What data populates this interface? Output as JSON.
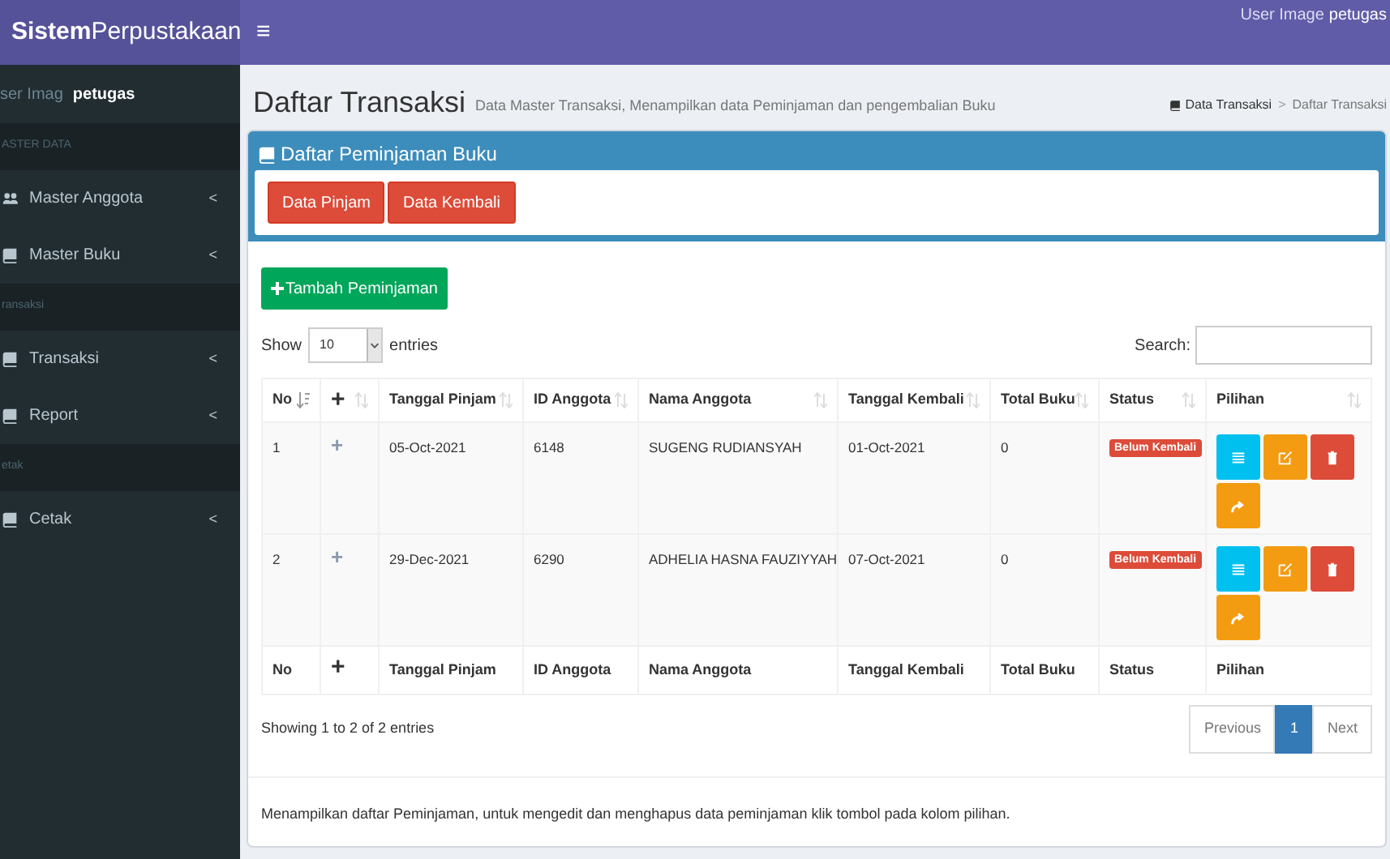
{
  "header": {
    "logo_bold": "Sistem",
    "logo_light": "Perpustakaan",
    "menu_toggle": "≡",
    "user_alt": "User Image",
    "user_name": "petugas"
  },
  "sidebar": {
    "user_alt": "ser Imag",
    "user_name": "petugas",
    "items": [
      {
        "kind": "header",
        "label": "ASTER DATA"
      },
      {
        "kind": "link",
        "label": "Master Anggota",
        "chevron": "<"
      },
      {
        "kind": "link",
        "label": "Master Buku",
        "chevron": "<"
      },
      {
        "kind": "header",
        "label": "ransaksi"
      },
      {
        "kind": "link",
        "label": "Transaksi",
        "chevron": "<"
      },
      {
        "kind": "link",
        "label": "Report",
        "chevron": "<"
      },
      {
        "kind": "header",
        "label": "etak"
      },
      {
        "kind": "link",
        "label": "Cetak",
        "chevron": "<"
      }
    ]
  },
  "page_header": {
    "title": "Daftar Transaksi",
    "subtitle": "Data Master Transaksi, Menampilkan data Peminjaman dan pengembalian Buku",
    "breadcrumb": [
      "Data Transaksi",
      "Daftar Transaksi"
    ],
    "breadcrumb_separator": ">"
  },
  "box": {
    "title": "Daftar Peminjaman Buku",
    "tabs": [
      "Data Pinjam",
      "Data Kembali"
    ],
    "add_button": "Tambah Peminjaman",
    "length": {
      "before": "Show",
      "value": "10",
      "after": "entries"
    },
    "search_label": "Search:",
    "columns": [
      "No",
      "+",
      "Tanggal Pinjam",
      "ID Anggota",
      "Nama Anggota",
      "Tanggal Kembali",
      "Total Buku",
      "Status",
      "Pilihan"
    ],
    "rows": [
      {
        "cells": [
          "1",
          "+",
          "05-Oct-2021",
          "6148",
          "SUGENG RUDIANSYAH",
          "01-Oct-2021",
          "0"
        ],
        "status": "Belum Kembali"
      },
      {
        "cells": [
          "2",
          "+",
          "29-Dec-2021",
          "6290",
          "ADHELIA HASNA FAUZIYYAH",
          "07-Oct-2021",
          "0"
        ],
        "status": "Belum Kembali"
      }
    ],
    "footer_columns": [
      "No",
      "+",
      "Tanggal Pinjam",
      "ID Anggota",
      "Nama Anggota",
      "Tanggal Kembali",
      "Total Buku",
      "Status",
      "Pilihan"
    ],
    "info": "Showing 1 to 2 of 2 entries",
    "pagination": [
      {
        "label": "Previous",
        "selected": false
      },
      {
        "label": "1",
        "selected": true
      },
      {
        "label": "Next",
        "selected": false
      }
    ],
    "note": "Menampilkan daftar Peminjaman, untuk mengedit dan menghapus data peminjaman klik tombol pada kolom pilihan."
  }
}
